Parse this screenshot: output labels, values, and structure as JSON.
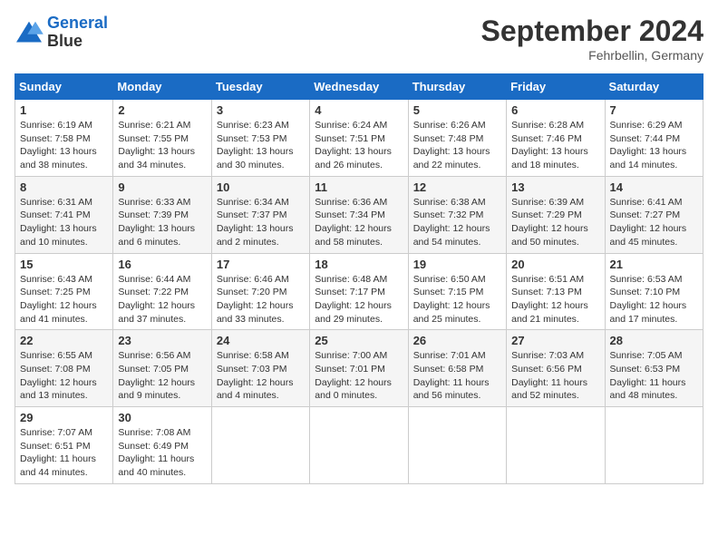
{
  "header": {
    "logo_line1": "General",
    "logo_line2": "Blue",
    "month": "September 2024",
    "location": "Fehrbellin, Germany"
  },
  "weekdays": [
    "Sunday",
    "Monday",
    "Tuesday",
    "Wednesday",
    "Thursday",
    "Friday",
    "Saturday"
  ],
  "weeks": [
    [
      {
        "day": "1",
        "rise": "6:19 AM",
        "set": "7:58 PM",
        "daylight": "13 hours and 38 minutes."
      },
      {
        "day": "2",
        "rise": "6:21 AM",
        "set": "7:55 PM",
        "daylight": "13 hours and 34 minutes."
      },
      {
        "day": "3",
        "rise": "6:23 AM",
        "set": "7:53 PM",
        "daylight": "13 hours and 30 minutes."
      },
      {
        "day": "4",
        "rise": "6:24 AM",
        "set": "7:51 PM",
        "daylight": "13 hours and 26 minutes."
      },
      {
        "day": "5",
        "rise": "6:26 AM",
        "set": "7:48 PM",
        "daylight": "13 hours and 22 minutes."
      },
      {
        "day": "6",
        "rise": "6:28 AM",
        "set": "7:46 PM",
        "daylight": "13 hours and 18 minutes."
      },
      {
        "day": "7",
        "rise": "6:29 AM",
        "set": "7:44 PM",
        "daylight": "13 hours and 14 minutes."
      }
    ],
    [
      {
        "day": "8",
        "rise": "6:31 AM",
        "set": "7:41 PM",
        "daylight": "13 hours and 10 minutes."
      },
      {
        "day": "9",
        "rise": "6:33 AM",
        "set": "7:39 PM",
        "daylight": "13 hours and 6 minutes."
      },
      {
        "day": "10",
        "rise": "6:34 AM",
        "set": "7:37 PM",
        "daylight": "13 hours and 2 minutes."
      },
      {
        "day": "11",
        "rise": "6:36 AM",
        "set": "7:34 PM",
        "daylight": "12 hours and 58 minutes."
      },
      {
        "day": "12",
        "rise": "6:38 AM",
        "set": "7:32 PM",
        "daylight": "12 hours and 54 minutes."
      },
      {
        "day": "13",
        "rise": "6:39 AM",
        "set": "7:29 PM",
        "daylight": "12 hours and 50 minutes."
      },
      {
        "day": "14",
        "rise": "6:41 AM",
        "set": "7:27 PM",
        "daylight": "12 hours and 45 minutes."
      }
    ],
    [
      {
        "day": "15",
        "rise": "6:43 AM",
        "set": "7:25 PM",
        "daylight": "12 hours and 41 minutes."
      },
      {
        "day": "16",
        "rise": "6:44 AM",
        "set": "7:22 PM",
        "daylight": "12 hours and 37 minutes."
      },
      {
        "day": "17",
        "rise": "6:46 AM",
        "set": "7:20 PM",
        "daylight": "12 hours and 33 minutes."
      },
      {
        "day": "18",
        "rise": "6:48 AM",
        "set": "7:17 PM",
        "daylight": "12 hours and 29 minutes."
      },
      {
        "day": "19",
        "rise": "6:50 AM",
        "set": "7:15 PM",
        "daylight": "12 hours and 25 minutes."
      },
      {
        "day": "20",
        "rise": "6:51 AM",
        "set": "7:13 PM",
        "daylight": "12 hours and 21 minutes."
      },
      {
        "day": "21",
        "rise": "6:53 AM",
        "set": "7:10 PM",
        "daylight": "12 hours and 17 minutes."
      }
    ],
    [
      {
        "day": "22",
        "rise": "6:55 AM",
        "set": "7:08 PM",
        "daylight": "12 hours and 13 minutes."
      },
      {
        "day": "23",
        "rise": "6:56 AM",
        "set": "7:05 PM",
        "daylight": "12 hours and 9 minutes."
      },
      {
        "day": "24",
        "rise": "6:58 AM",
        "set": "7:03 PM",
        "daylight": "12 hours and 4 minutes."
      },
      {
        "day": "25",
        "rise": "7:00 AM",
        "set": "7:01 PM",
        "daylight": "12 hours and 0 minutes."
      },
      {
        "day": "26",
        "rise": "7:01 AM",
        "set": "6:58 PM",
        "daylight": "11 hours and 56 minutes."
      },
      {
        "day": "27",
        "rise": "7:03 AM",
        "set": "6:56 PM",
        "daylight": "11 hours and 52 minutes."
      },
      {
        "day": "28",
        "rise": "7:05 AM",
        "set": "6:53 PM",
        "daylight": "11 hours and 48 minutes."
      }
    ],
    [
      {
        "day": "29",
        "rise": "7:07 AM",
        "set": "6:51 PM",
        "daylight": "11 hours and 44 minutes."
      },
      {
        "day": "30",
        "rise": "7:08 AM",
        "set": "6:49 PM",
        "daylight": "11 hours and 40 minutes."
      },
      null,
      null,
      null,
      null,
      null
    ]
  ]
}
